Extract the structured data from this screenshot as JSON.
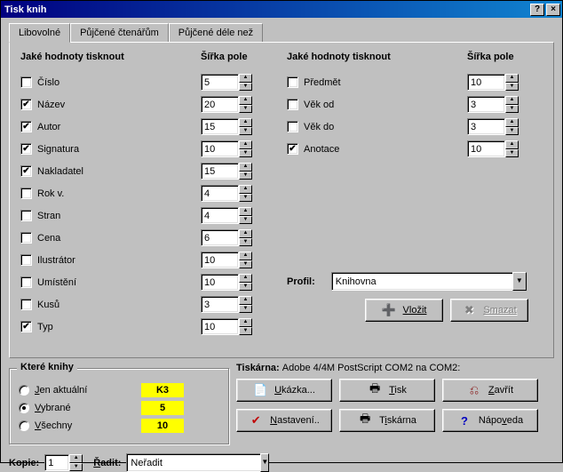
{
  "window": {
    "title": "Tisk knih"
  },
  "tabs": [
    "Libovolné",
    "Půjčené čtenářům",
    "Půjčené déle než"
  ],
  "active_tab": 0,
  "headers": {
    "values": "Jaké hodnoty tisknout",
    "width": "Šířka pole"
  },
  "left_fields": [
    {
      "label": "Číslo",
      "checked": false,
      "width": "5"
    },
    {
      "label": "Název",
      "checked": true,
      "width": "20"
    },
    {
      "label": "Autor",
      "checked": true,
      "width": "15"
    },
    {
      "label": "Signatura",
      "checked": true,
      "width": "10"
    },
    {
      "label": "Nakladatel",
      "checked": true,
      "width": "15"
    },
    {
      "label": "Rok v.",
      "checked": false,
      "width": "4"
    },
    {
      "label": "Stran",
      "checked": false,
      "width": "4"
    },
    {
      "label": "Cena",
      "checked": false,
      "width": "6"
    },
    {
      "label": "Ilustrátor",
      "checked": false,
      "width": "10"
    },
    {
      "label": "Umístění",
      "checked": false,
      "width": "10"
    },
    {
      "label": "Kusů",
      "checked": false,
      "width": "3"
    },
    {
      "label": "Typ",
      "checked": true,
      "width": "10"
    }
  ],
  "right_fields": [
    {
      "label": "Předmět",
      "checked": false,
      "width": "10"
    },
    {
      "label": "Věk od",
      "checked": false,
      "width": "3"
    },
    {
      "label": "Věk do",
      "checked": false,
      "width": "3"
    },
    {
      "label": "Anotace",
      "checked": true,
      "width": "10"
    }
  ],
  "profile": {
    "label": "Profil:",
    "value": "Knihovna"
  },
  "profile_buttons": {
    "insert": "Vložit",
    "delete": "Smazat"
  },
  "books_group": {
    "legend": "Které knihy",
    "options": [
      {
        "label": "Jen aktuální",
        "selected": false,
        "count": "K3"
      },
      {
        "label": "Vybrané",
        "selected": true,
        "count": "5"
      },
      {
        "label": "Všechny",
        "selected": false,
        "count": "10"
      }
    ]
  },
  "printer": {
    "label": "Tiskárna:",
    "value": "Adobe 4/4M PostScript COM2 na COM2:"
  },
  "buttons": {
    "preview": "Ukázka...",
    "print": "Tisk",
    "close": "Zavřít",
    "settings": "Nastavení...",
    "printer": "Tiskárna",
    "help": "Nápoveda"
  },
  "copies": {
    "label": "Kopie:",
    "value": "1"
  },
  "sort": {
    "label": "Řadit:",
    "value": "Neřadit"
  }
}
